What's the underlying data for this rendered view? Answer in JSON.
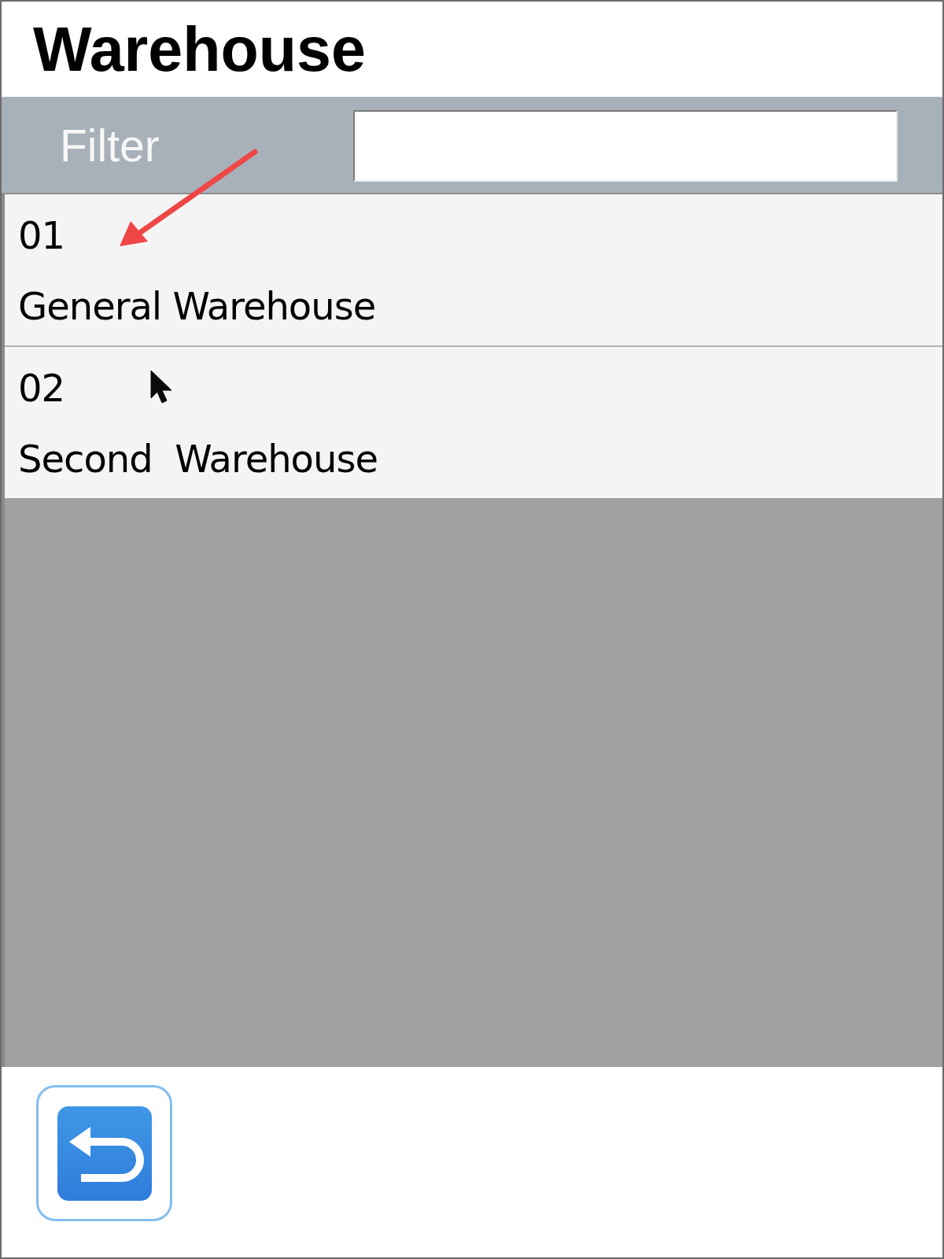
{
  "title": "Warehouse",
  "filter": {
    "label": "Filter"
  },
  "warehouses": [
    {
      "code": "01",
      "name": "General Warehouse"
    },
    {
      "code": "02",
      "name": "Second  Warehouse"
    }
  ]
}
